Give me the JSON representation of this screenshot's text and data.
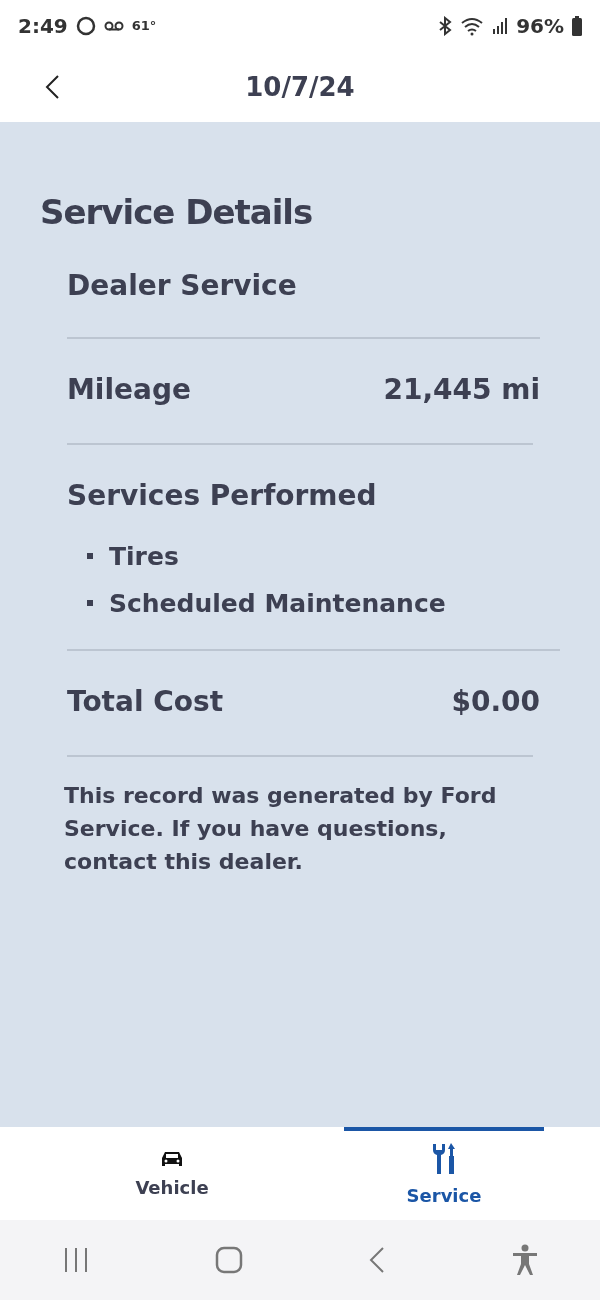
{
  "status_bar": {
    "time": "2:49",
    "temperature": "61°",
    "battery": "96%"
  },
  "header": {
    "title": "10/7/24"
  },
  "details": {
    "heading": "Service Details",
    "service_type": "Dealer Service",
    "mileage": {
      "label": "Mileage",
      "value": "21,445 mi"
    },
    "services": {
      "label": "Services Performed",
      "items": [
        "Tires",
        "Scheduled Maintenance"
      ]
    },
    "total": {
      "label": "Total Cost",
      "value": "$0.00"
    },
    "note": "This record was generated by Ford Service. If you have questions, contact this dealer."
  },
  "tabs": [
    {
      "label": "Vehicle",
      "kind": "vehicle",
      "selected": false
    },
    {
      "label": "Service",
      "kind": "service",
      "selected": true
    }
  ]
}
